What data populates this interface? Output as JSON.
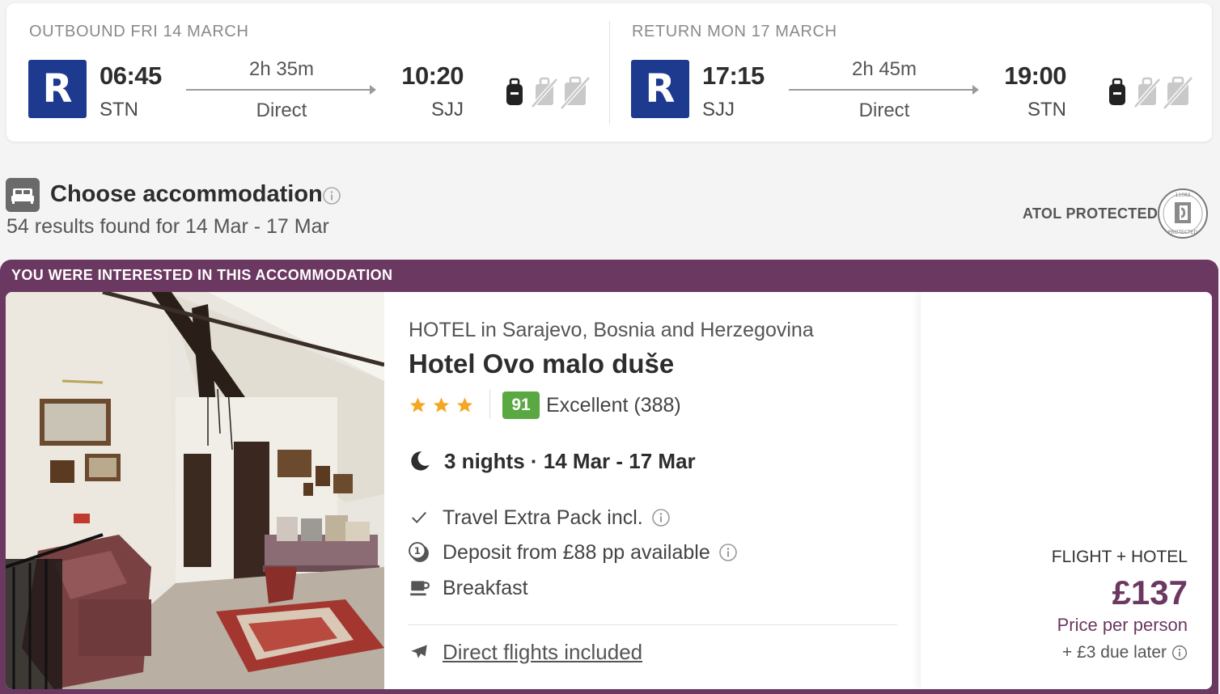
{
  "outbound": {
    "title": "OUTBOUND FRI 14 MARCH",
    "airline_logo": "R",
    "dep_time": "06:45",
    "dep_airport": "STN",
    "duration": "2h 35m",
    "stops": "Direct",
    "arr_time": "10:20",
    "arr_airport": "SJJ",
    "icons": [
      "cabin-bag-included-icon",
      "checked-bag-not-included-icon",
      "hold-bag-not-included-icon"
    ]
  },
  "return": {
    "title": "RETURN MON 17 MARCH",
    "airline_logo": "R",
    "dep_time": "17:15",
    "dep_airport": "SJJ",
    "duration": "2h 45m",
    "stops": "Direct",
    "arr_time": "19:00",
    "arr_airport": "STN",
    "icons": [
      "cabin-bag-included-icon",
      "checked-bag-not-included-icon",
      "hold-bag-not-included-icon"
    ]
  },
  "section": {
    "title": "Choose accommodation",
    "results": "54 results found for 14 Mar - 17 Mar",
    "atol": "ATOL PROTECTED",
    "atol_badge_text": "11082 PROTECTED"
  },
  "interest": {
    "label": "YOU WERE INTERESTED IN THIS ACCOMMODATION"
  },
  "hotel": {
    "type": "HOTEL in Sarajevo, Bosnia and Herzegovina",
    "name": "Hotel Ovo malo duše",
    "stars": 3,
    "rating_score": "91",
    "rating_text": "Excellent (388)",
    "stay": "3 nights · 14 Mar - 17 Mar",
    "features": [
      {
        "icon": "check-icon",
        "label": "Travel Extra Pack incl."
      },
      {
        "icon": "deposit-icon",
        "label": "Deposit from £88 pp available"
      },
      {
        "icon": "coffee-cup-icon",
        "label": "Breakfast"
      }
    ],
    "direct_flights": "Direct flights included"
  },
  "price": {
    "label": "FLIGHT + HOTEL",
    "value": "£137",
    "per_person": "Price per person",
    "due_later": "+ £3 due later"
  },
  "colors": {
    "brand_purple": "#6b3861",
    "ryanair_blue": "#1d3a8f",
    "rating_green": "#5aa842",
    "star_orange": "#f5a623"
  }
}
